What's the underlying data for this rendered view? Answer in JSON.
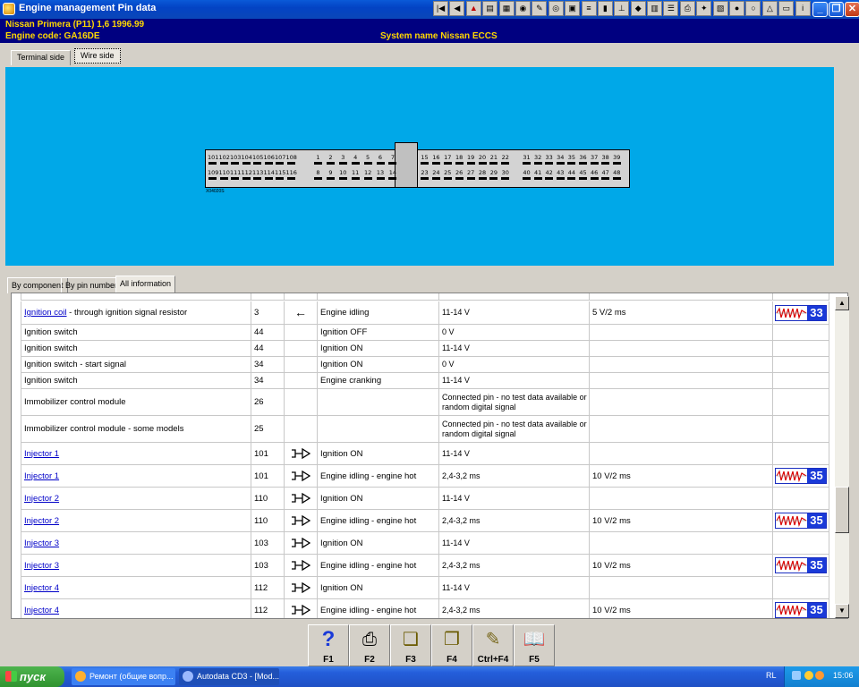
{
  "window": {
    "title": "Engine management Pin data",
    "toolbar_icons": [
      "first-icon",
      "prev-icon",
      "warning-icon",
      "doc-icon",
      "chart-icon",
      "camera-icon",
      "wrench-icon",
      "gauge-icon",
      "components-icon",
      "timing-icon",
      "battery-icon",
      "lift-icon",
      "diagram-icon",
      "data-icon",
      "notes-icon",
      "print-icon",
      "tools-icon",
      "graph-icon",
      "ecu-icon",
      "wheel-icon",
      "light-icon",
      "car-icon",
      "info-icon"
    ]
  },
  "vehicle": {
    "name": "Nissan  Primera (P11) 1,6  1996.99",
    "engine_code": "Engine code: GA16DE",
    "system": "System name Nissan ECCS"
  },
  "view_tabs": [
    "Terminal side",
    "Wire side"
  ],
  "connector": {
    "top_row_left": [
      "101",
      "102",
      "103",
      "104",
      "105",
      "106",
      "107",
      "108"
    ],
    "top_row_mid": [
      "1",
      "2",
      "3",
      "4",
      "5",
      "6",
      "7"
    ],
    "top_row_right1": [
      "15",
      "16",
      "17",
      "18",
      "19",
      "20",
      "21",
      "22"
    ],
    "top_row_right2": [
      "31",
      "32",
      "33",
      "34",
      "35",
      "36",
      "37",
      "38",
      "39"
    ],
    "bot_row_left": [
      "109",
      "110",
      "111",
      "112",
      "113",
      "114",
      "115",
      "116"
    ],
    "bot_row_mid": [
      "8",
      "9",
      "10",
      "11",
      "12",
      "13",
      "14"
    ],
    "bot_row_right1": [
      "23",
      "24",
      "25",
      "26",
      "27",
      "28",
      "29",
      "30"
    ],
    "bot_row_right2": [
      "40",
      "41",
      "42",
      "43",
      "44",
      "45",
      "46",
      "47",
      "48"
    ],
    "part_code": "X04020S"
  },
  "info_tabs": [
    "By component",
    "By pin number",
    "All information"
  ],
  "rows": [
    {
      "component": "Ignition coil",
      "component_suffix": " - through ignition signal resistor",
      "link": true,
      "pin": "3",
      "symbol": "arrow",
      "condition": "Engine idling",
      "value": "11-14 V",
      "scope": "5 V/2 ms",
      "waveform": "33"
    },
    {
      "component": "Ignition switch",
      "component_suffix": "",
      "link": false,
      "pin": "44",
      "symbol": "",
      "condition": "Ignition OFF",
      "value": "0 V",
      "scope": "",
      "waveform": ""
    },
    {
      "component": "Ignition switch",
      "component_suffix": "",
      "link": false,
      "pin": "44",
      "symbol": "",
      "condition": "Ignition ON",
      "value": "11-14 V",
      "scope": "",
      "waveform": ""
    },
    {
      "component": "Ignition switch - start signal",
      "component_suffix": "",
      "link": false,
      "pin": "34",
      "symbol": "",
      "condition": "Ignition ON",
      "value": "0 V",
      "scope": "",
      "waveform": ""
    },
    {
      "component": "Ignition switch",
      "component_suffix": "",
      "link": false,
      "pin": "34",
      "symbol": "",
      "condition": "Engine cranking",
      "value": "11-14 V",
      "scope": "",
      "waveform": ""
    },
    {
      "component": "Immobilizer control module",
      "component_suffix": "",
      "link": false,
      "pin": "26",
      "symbol": "",
      "condition": "",
      "value": "Connected pin - no test data available or random digital signal",
      "scope": "",
      "waveform": ""
    },
    {
      "component": "Immobilizer control module - some models",
      "component_suffix": "",
      "link": false,
      "pin": "25",
      "symbol": "",
      "condition": "",
      "value": "Connected pin - no test data available or random digital signal",
      "scope": "",
      "waveform": ""
    },
    {
      "component": "Injector 1",
      "component_suffix": "",
      "link": true,
      "pin": "101",
      "symbol": "injector",
      "condition": "Ignition ON",
      "value": "11-14 V",
      "scope": "",
      "waveform": ""
    },
    {
      "component": "Injector 1",
      "component_suffix": "",
      "link": true,
      "pin": "101",
      "symbol": "injector",
      "condition": "Engine idling - engine hot",
      "value": "2,4-3,2 ms",
      "scope": "10 V/2 ms",
      "waveform": "35"
    },
    {
      "component": "Injector 2",
      "component_suffix": "",
      "link": true,
      "pin": "110",
      "symbol": "injector",
      "condition": "Ignition ON",
      "value": "11-14 V",
      "scope": "",
      "waveform": ""
    },
    {
      "component": "Injector 2",
      "component_suffix": "",
      "link": true,
      "pin": "110",
      "symbol": "injector",
      "condition": "Engine idling - engine hot",
      "value": "2,4-3,2 ms",
      "scope": "10 V/2 ms",
      "waveform": "35"
    },
    {
      "component": "Injector 3",
      "component_suffix": "",
      "link": true,
      "pin": "103",
      "symbol": "injector",
      "condition": "Ignition ON",
      "value": "11-14 V",
      "scope": "",
      "waveform": ""
    },
    {
      "component": "Injector 3",
      "component_suffix": "",
      "link": true,
      "pin": "103",
      "symbol": "injector",
      "condition": "Engine idling - engine hot",
      "value": "2,4-3,2 ms",
      "scope": "10 V/2 ms",
      "waveform": "35"
    },
    {
      "component": "Injector 4",
      "component_suffix": "",
      "link": true,
      "pin": "112",
      "symbol": "injector",
      "condition": "Ignition ON",
      "value": "11-14 V",
      "scope": "",
      "waveform": ""
    },
    {
      "component": "Injector 4",
      "component_suffix": "",
      "link": true,
      "pin": "112",
      "symbol": "injector",
      "condition": "Engine idling - engine hot",
      "value": "2,4-3,2 ms",
      "scope": "10 V/2 ms",
      "waveform": "35"
    }
  ],
  "function_keys": [
    {
      "label": "F1",
      "icon": "help-icon"
    },
    {
      "label": "F2",
      "icon": "print-icon"
    },
    {
      "label": "F3",
      "icon": "copy-icon"
    },
    {
      "label": "F4",
      "icon": "copy-all-icon"
    },
    {
      "label": "Ctrl+F4",
      "icon": "notes-icon"
    },
    {
      "label": "F5",
      "icon": "book-icon"
    }
  ],
  "taskbar": {
    "start_label": "пуск",
    "tasks": [
      "Ремонт (общие вопр...",
      "Autodata CD3 - [Mod..."
    ],
    "lang": "RL",
    "time": "15:06"
  },
  "colors": {
    "panel": "#00a8e8",
    "title_bar": "#0343c4",
    "info_bar": "#000080",
    "info_text": "#ffd800",
    "link": "#0000c8"
  }
}
